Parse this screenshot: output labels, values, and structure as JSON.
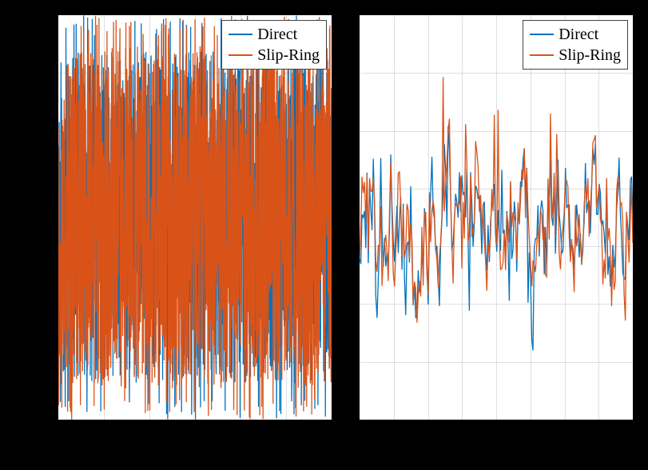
{
  "chart_data": [
    {
      "type": "line",
      "title": "",
      "xlabel": "",
      "ylabel": "",
      "xlim": [
        0,
        1
      ],
      "ylim": [
        -1,
        1
      ],
      "x_ticks_count": 6,
      "y_ticks_count": 7,
      "legend_position": "top-right",
      "series": [
        {
          "name": "Direct",
          "color": "#0072BD",
          "description": "dense noisy signal, amplitude roughly ±0.85 with spikes to ±1",
          "n_points_approx": 1500
        },
        {
          "name": "Slip-Ring",
          "color": "#D95319",
          "description": "dense noisy signal overlapping Direct, amplitude roughly ±0.88 with spikes to ±1",
          "n_points_approx": 1500
        }
      ]
    },
    {
      "type": "line",
      "title": "",
      "xlabel": "",
      "ylabel": "",
      "xlim": [
        0,
        1
      ],
      "ylim": [
        -1,
        1
      ],
      "x_ticks_count": 8,
      "y_ticks_count": 7,
      "legend_position": "top-right",
      "series": [
        {
          "name": "Direct",
          "color": "#0072BD",
          "description": "sparser noisy signal, center ~-0.05, amplitude range roughly -0.72 to 0.68",
          "n_points_approx": 220
        },
        {
          "name": "Slip-Ring",
          "color": "#D95319",
          "description": "sparser noisy signal tracking Direct with small differences, range roughly -0.72 to 0.80",
          "n_points_approx": 220
        }
      ]
    }
  ],
  "legend": {
    "series1_label": "Direct",
    "series2_label": "Slip-Ring"
  }
}
